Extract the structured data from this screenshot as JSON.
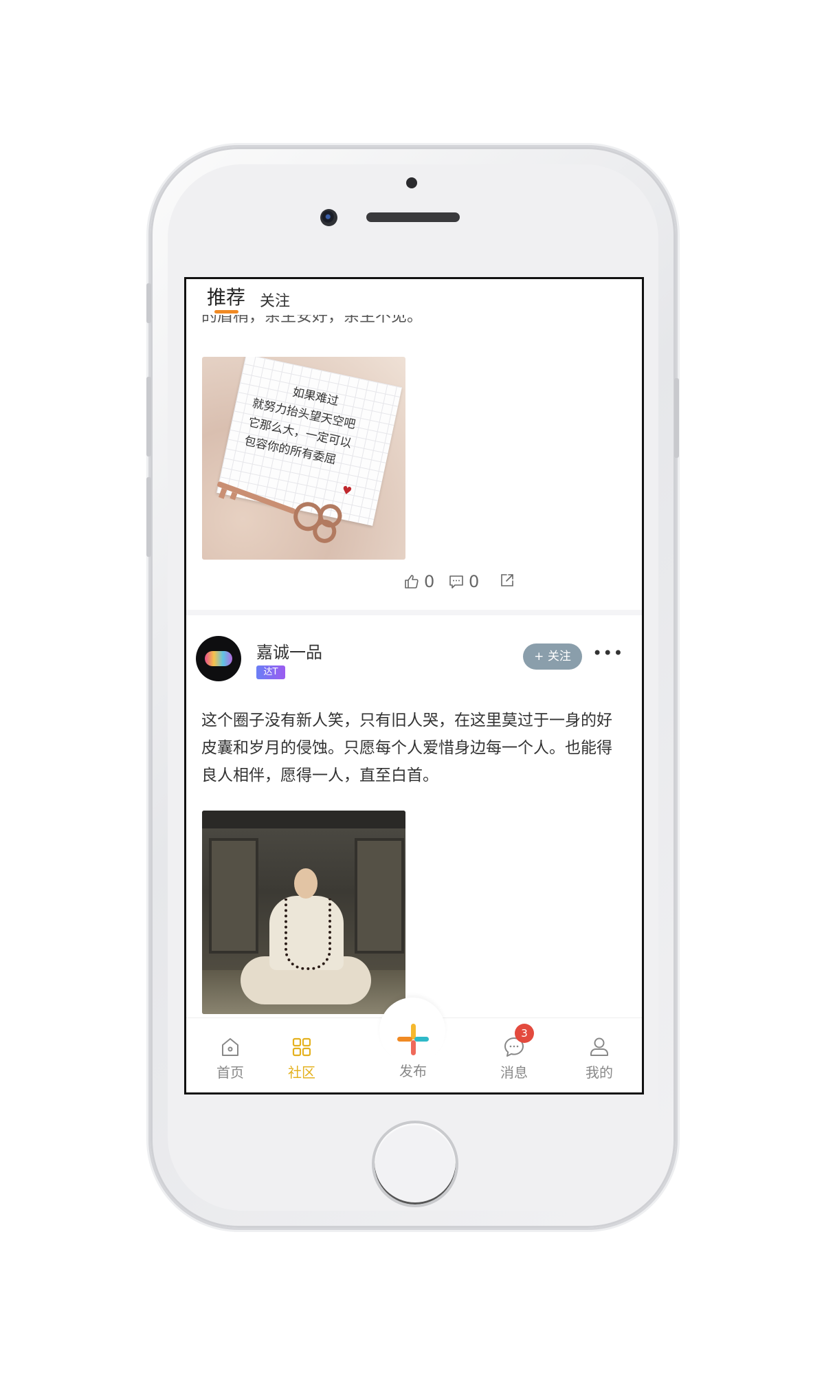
{
  "tabs": {
    "recommend": "推荐",
    "follow": "关注"
  },
  "post1": {
    "text_cut": "的眉梢，余生安好，余生不见。",
    "image_text": [
      "如果难过",
      "就努力抬头望天空吧",
      "它那么大，一定可以",
      "包容你的所有委屈"
    ],
    "likes": "0",
    "comments": "0"
  },
  "post2": {
    "username": "嘉诚一品",
    "badge": "达T",
    "follow_label": "+ 关注",
    "more_label": "•••",
    "text": "这个圈子没有新人笑，只有旧人哭，在这里莫过于一身的好皮囊和岁月的侵蚀。只愿每个人爱惜身边每一个人。也能得良人相伴，愿得一人，直至白首。"
  },
  "tabbar": {
    "home": "首页",
    "community": "社区",
    "publish": "发布",
    "messages": "消息",
    "messages_badge": "3",
    "mine": "我的"
  },
  "colors": {
    "accent_orange": "#f08a24",
    "active_tab": "#e4b11e",
    "badge_red": "#e34a3e",
    "follow_button": "#8a9eab"
  },
  "icons": [
    "like-icon",
    "comment-icon",
    "share-icon",
    "home-icon",
    "community-icon",
    "publish-icon",
    "message-icon",
    "profile-icon"
  ]
}
